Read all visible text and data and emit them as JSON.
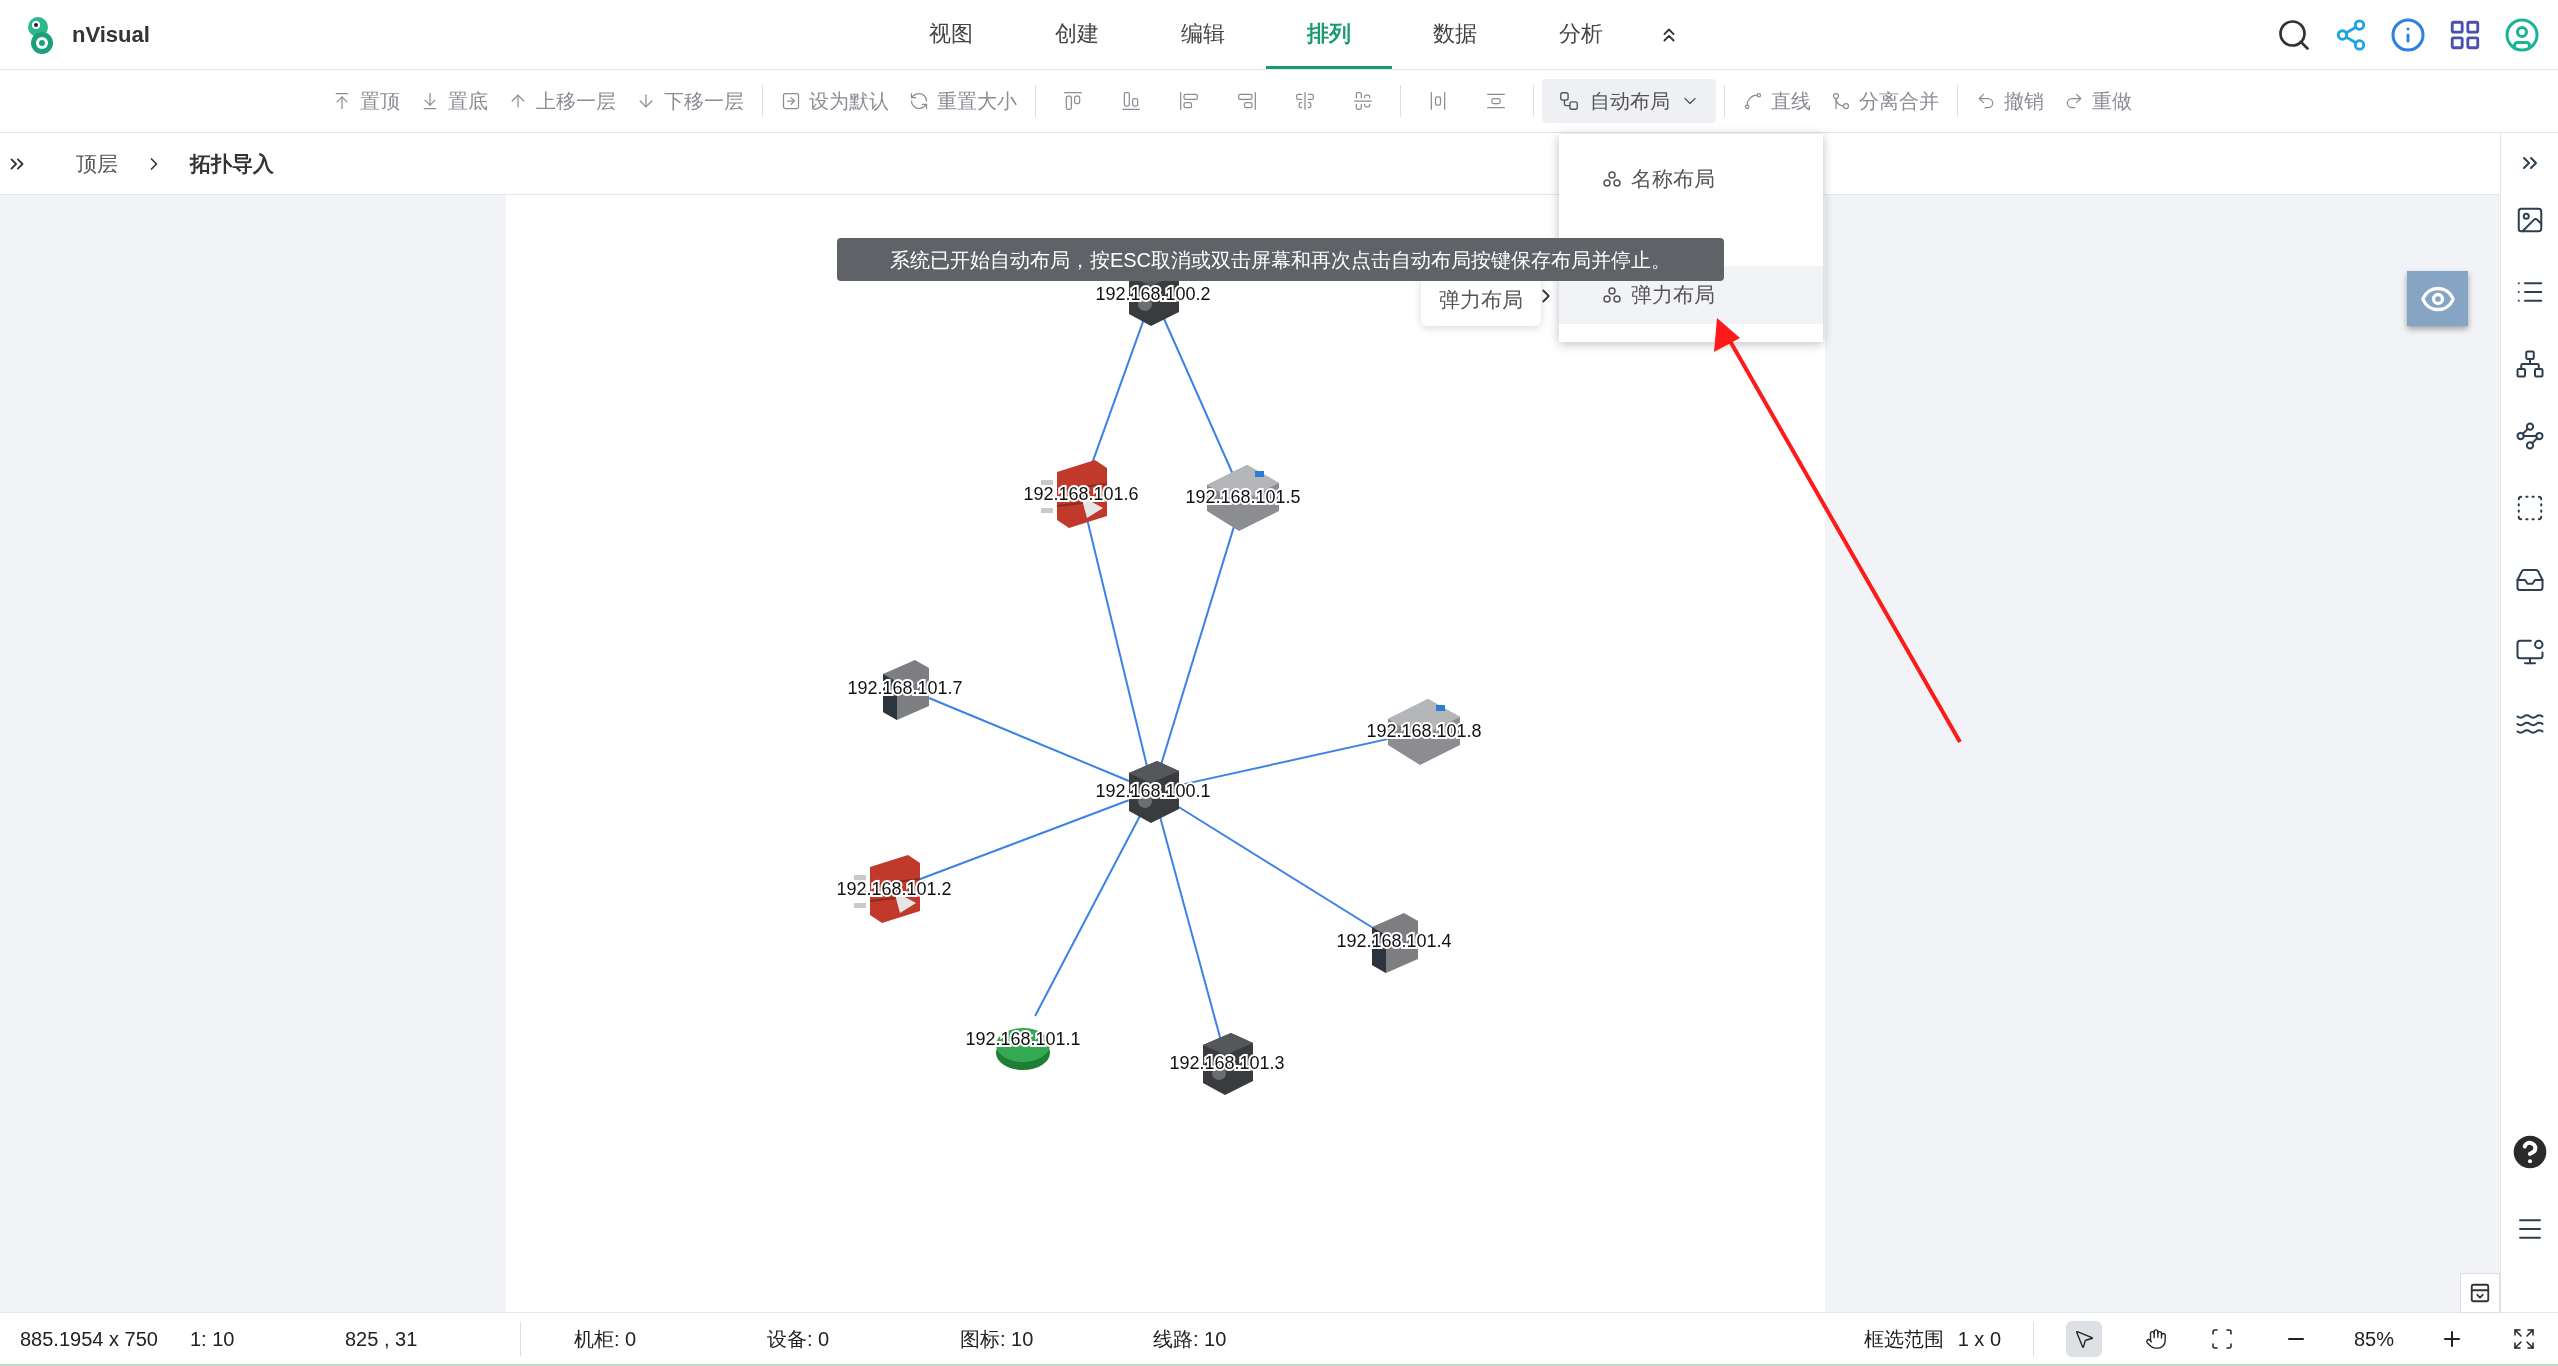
{
  "app": {
    "name": "nVisual"
  },
  "nav": {
    "tabs": [
      {
        "label": "视图",
        "selected": false
      },
      {
        "label": "创建",
        "selected": false
      },
      {
        "label": "编辑",
        "selected": false
      },
      {
        "label": "排列",
        "selected": true
      },
      {
        "label": "数据",
        "selected": false
      },
      {
        "label": "分析",
        "selected": false
      }
    ]
  },
  "toolbar": {
    "groups": [
      [
        {
          "kind": "button",
          "label": "置顶"
        },
        {
          "kind": "button",
          "label": "置底"
        },
        {
          "kind": "button",
          "label": "上移一层"
        },
        {
          "kind": "button",
          "label": "下移一层"
        }
      ],
      [
        {
          "kind": "button",
          "label": "设为默认"
        },
        {
          "kind": "button",
          "label": "重置大小"
        }
      ],
      [
        {
          "kind": "icon"
        },
        {
          "kind": "icon"
        },
        {
          "kind": "icon"
        },
        {
          "kind": "icon"
        },
        {
          "kind": "icon"
        },
        {
          "kind": "icon"
        }
      ],
      [
        {
          "kind": "icon"
        },
        {
          "kind": "icon"
        }
      ],
      [
        {
          "kind": "dropdown",
          "label": "自动布局",
          "expanded": true
        }
      ],
      [
        {
          "kind": "button",
          "label": "直线"
        },
        {
          "kind": "button",
          "label": "分离合并"
        }
      ],
      [
        {
          "kind": "button",
          "label": "撤销"
        },
        {
          "kind": "button",
          "label": "重做"
        }
      ]
    ]
  },
  "breadcrumb": [
    "顶层",
    "拓扑导入"
  ],
  "layout_menu": {
    "items": [
      {
        "label": "名称布局",
        "selected": false
      },
      {
        "label": "弹力布局",
        "selected": true
      }
    ]
  },
  "submenu_hint": {
    "label": "弹力布局"
  },
  "toast": {
    "text": "系统已开始自动布局，按ESC取消或双击屏幕和再次点击自动布局按键保存布局并停止。"
  },
  "topology": {
    "nodes": [
      {
        "label": "192.168.100.2",
        "kind": "switch"
      },
      {
        "label": "192.168.101.6",
        "kind": "firewall"
      },
      {
        "label": "192.168.101.5",
        "kind": "storage"
      },
      {
        "label": "192.168.101.7",
        "kind": "server"
      },
      {
        "label": "192.168.100.1",
        "kind": "switch"
      },
      {
        "label": "192.168.101.8",
        "kind": "storage"
      },
      {
        "label": "192.168.101.2",
        "kind": "firewall"
      },
      {
        "label": "192.168.101.4",
        "kind": "server"
      },
      {
        "label": "192.168.101.1",
        "kind": "router"
      },
      {
        "label": "192.168.101.3",
        "kind": "switch"
      }
    ]
  },
  "status_bar": {
    "size": "885.1954 x 750",
    "scale": "1: 10",
    "cursor": "825 , 31",
    "counts": [
      "机柜: 0",
      "设备: 0",
      "图标: 10",
      "线路: 10"
    ],
    "selection_label": "框选范围",
    "selection_value": "1 x 0",
    "tools": [
      {
        "kind": "pointer",
        "selected": true
      },
      {
        "kind": "hand",
        "selected": false
      }
    ],
    "zoom": "85%"
  }
}
